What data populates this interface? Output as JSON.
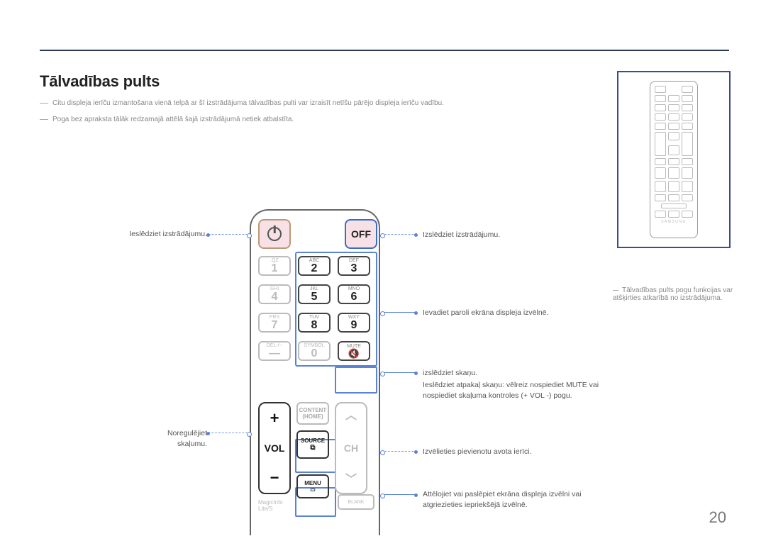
{
  "title": "Tālvadības pults",
  "notes": [
    "Citu displeja ierīču izmantošana vienā telpā ar šī izstrādājuma tālvadības pulti var izraisīt netīšu pārējo displeja ierīču vadību.",
    "Poga bez apraksta tālāk redzamajā attēlā šajā izstrādājumā netiek atbalstīta."
  ],
  "remote": {
    "off": "OFF",
    "keys": {
      "k1": {
        "sub": ".QZ",
        "main": "1"
      },
      "k2": {
        "sub": "ABC",
        "main": "2"
      },
      "k3": {
        "sub": "DEF",
        "main": "3"
      },
      "k4": {
        "sub": "GHI",
        "main": "4"
      },
      "k5": {
        "sub": "JKL",
        "main": "5"
      },
      "k6": {
        "sub": "MNO",
        "main": "6"
      },
      "k7": {
        "sub": "PRS",
        "main": "7"
      },
      "k8": {
        "sub": "TUV",
        "main": "8"
      },
      "k9": {
        "sub": "WXY",
        "main": "9"
      },
      "del": {
        "sub": "DEL-/--",
        "main": "—"
      },
      "k0": {
        "sub": "SYMBOL",
        "main": "0"
      },
      "mute_sub": "MUTE"
    },
    "vol": "VOL",
    "ch": "CH",
    "content": "CONTENT",
    "home": "(HOME)",
    "source": "SOURCE",
    "menu": "MENU",
    "magicinfo": "MagicInfo",
    "lite": "Lite/S",
    "blank": "BLANK",
    "brand": "SAMSUNG"
  },
  "callouts": {
    "power_on": "Ieslēdziet izstrādājumu.",
    "power_off": "Izslēdziet izstrādājumu.",
    "numpad": "Ievadiet paroli ekrāna displeja izvēlnē.",
    "mute1": "izslēdziet skaņu.",
    "mute2": "Ieslēdziet atpakaļ skaņu: vēlreiz nospiediet MUTE vai nospiediet skaļuma kontroles (+ VOL -) pogu.",
    "vol": "Noregulējiet skaļumu.",
    "source": "Izvēlieties pievienotu avota ierīci.",
    "menu": "Attēlojiet vai paslēpiet ekrāna displeja izvēlni vai atgriezieties iepriekšējā izvēlnē."
  },
  "thumb_note": "Tālvadības pults pogu funkcijas var atšķirties atkarībā no izstrādājuma.",
  "page": "20"
}
